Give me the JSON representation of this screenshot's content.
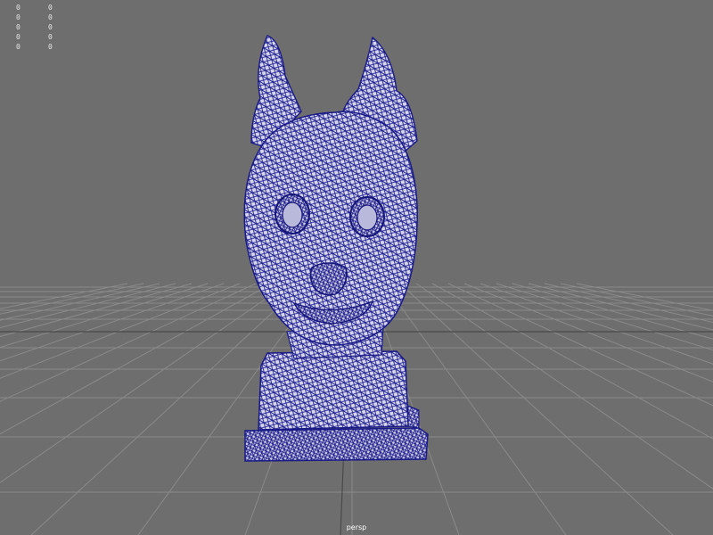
{
  "viewport": {
    "camera_label": "persp",
    "background_color": "#6e6e6e",
    "grid_color": "#8a8a8a",
    "grid_center_line_color": "#4a4a4a",
    "wireframe_color": "#1f1f8f",
    "mesh_fill_color": "#d8d8ee"
  },
  "hud_stats": {
    "col1": [
      "0",
      "0",
      "0",
      "0",
      "0"
    ],
    "col2": [
      "0",
      "0",
      "0",
      "0",
      "0"
    ]
  },
  "object": {
    "icon": "rabbit-head-bust-wireframe-mesh"
  }
}
